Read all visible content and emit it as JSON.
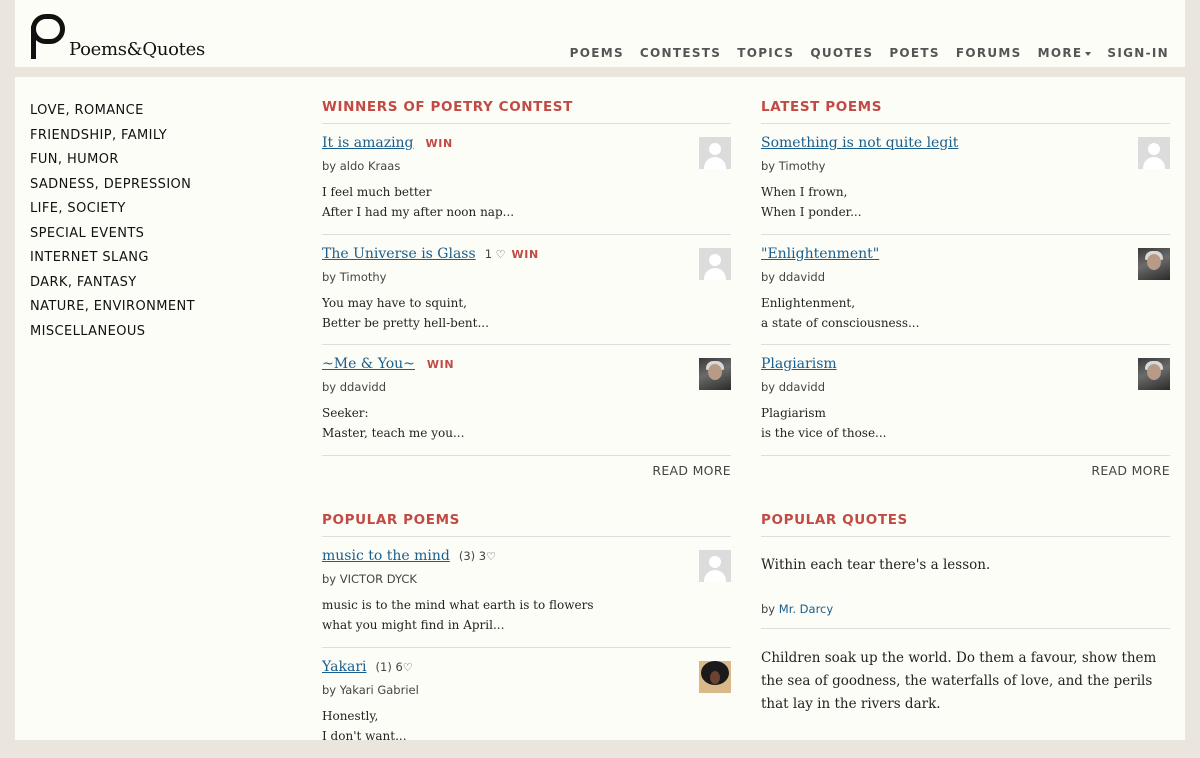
{
  "site": {
    "name": "Poems&Quotes"
  },
  "nav": {
    "items": [
      "POEMS",
      "CONTESTS",
      "TOPICS",
      "QUOTES",
      "POETS",
      "FORUMS",
      "MORE",
      "SIGN-IN"
    ]
  },
  "sidebar": {
    "items": [
      "LOVE, ROMANCE",
      "FRIENDSHIP, FAMILY",
      "FUN, HUMOR",
      "SADNESS, DEPRESSION",
      "LIFE, SOCIETY",
      "SPECIAL EVENTS",
      "INTERNET SLANG",
      "DARK, FANTASY",
      "NATURE, ENVIRONMENT",
      "MISCELLANEOUS"
    ]
  },
  "winners": {
    "title": "WINNERS OF POETRY CONTEST",
    "read_more": "READ MORE",
    "poems": [
      {
        "title": "It is amazing",
        "win": "WIN",
        "by": "by aldo Kraas",
        "line1": "I feel much better",
        "line2": "After I had my after noon nap...",
        "avatar": "default-avatar"
      },
      {
        "title": "The Universe is Glass",
        "stats": "1",
        "win": "WIN",
        "by": "by Timothy",
        "line1": "You may have to squint,",
        "line2": "Better be pretty hell-bent...",
        "avatar": "default-avatar"
      },
      {
        "title": "~Me & You~",
        "win": "WIN",
        "by": "by ddavidd",
        "line1": "Seeker:",
        "line2": "Master, teach me you...",
        "avatar": "user-photo"
      }
    ]
  },
  "latest": {
    "title": "LATEST POEMS",
    "read_more": "READ MORE",
    "poems": [
      {
        "title": "Something is not quite legit",
        "by": "by Timothy",
        "line1": "When I frown,",
        "line2": "When I ponder...",
        "avatar": "default-avatar"
      },
      {
        "title": "\"Enlightenment\"",
        "by": "by ddavidd",
        "line1": "Enlightenment,",
        "line2": "a state of consciousness...",
        "avatar": "user-photo"
      },
      {
        "title": "Plagiarism",
        "by": "by ddavidd",
        "line1": "Plagiarism",
        "line2": "is the vice of those...",
        "avatar": "user-photo"
      }
    ]
  },
  "popular_poems": {
    "title": "POPULAR POEMS",
    "poems": [
      {
        "title": "music to the mind",
        "stats": "(3) 3",
        "by": "by VICTOR DYCK",
        "line1": "music is to the mind what earth is to flowers",
        "line2": "what you might find in April...",
        "avatar": "default-avatar"
      },
      {
        "title": "Yakari",
        "stats": "(1) 6",
        "by": "by Yakari Gabriel",
        "line1": "Honestly,",
        "line2": "I don't want...",
        "avatar": "user-photo"
      }
    ]
  },
  "popular_quotes": {
    "title": "POPULAR QUOTES",
    "quotes": [
      {
        "text": "Within each tear there's a lesson.",
        "by_prefix": "by",
        "author": "Mr. Darcy"
      },
      {
        "text": "Children soak up the world. Do them a favour, show them the sea of goodness, the waterfalls of love, and the perils that lay in the rivers dark."
      }
    ]
  },
  "colors": {
    "accent": "#c24a44",
    "link": "#1a5e8c",
    "background": "#ebe6dd",
    "panel": "#fdfdf8"
  }
}
